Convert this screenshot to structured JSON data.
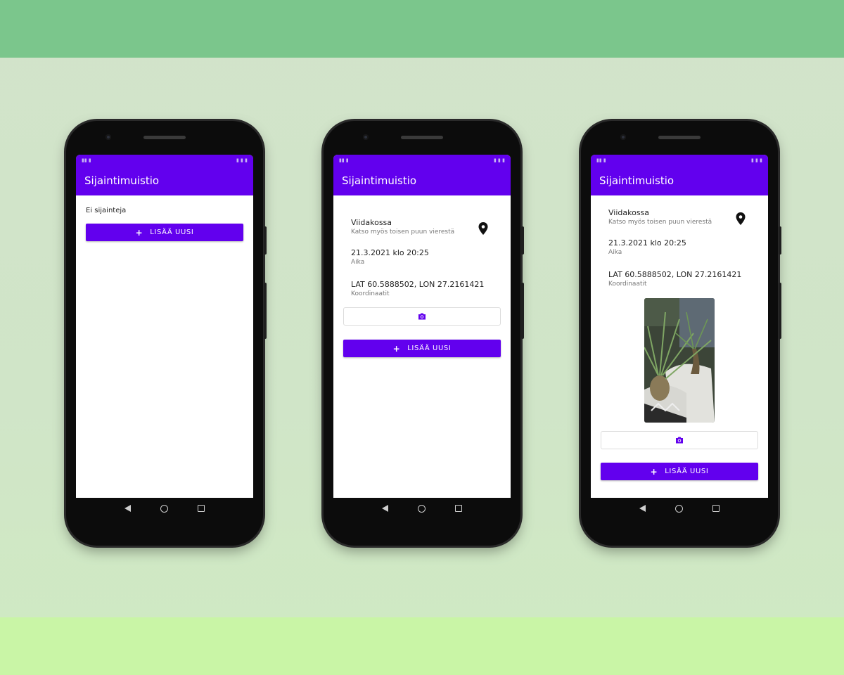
{
  "app": {
    "title": "Sijaintimuistio"
  },
  "empty_text": "Ei sijainteja",
  "add_button_label": "LISÄÄ UUSI",
  "location": {
    "name": "Viidakossa",
    "description": "Katso myös toisen puun vierestä",
    "time_value": "21.3.2021 klo 20:25",
    "time_label": "Aika",
    "coords_value": "LAT 60.5888502,  LON 27.2161421",
    "coords_label": "Koordinaatit"
  },
  "icons": [
    "map-pin-icon",
    "camera-icon",
    "back-icon",
    "home-icon",
    "recents-icon"
  ],
  "colors": {
    "accent": "#6200ee",
    "background": "#d2e3ca",
    "band_top": "#7bc68c",
    "band_bottom": "#c9f5a6"
  }
}
